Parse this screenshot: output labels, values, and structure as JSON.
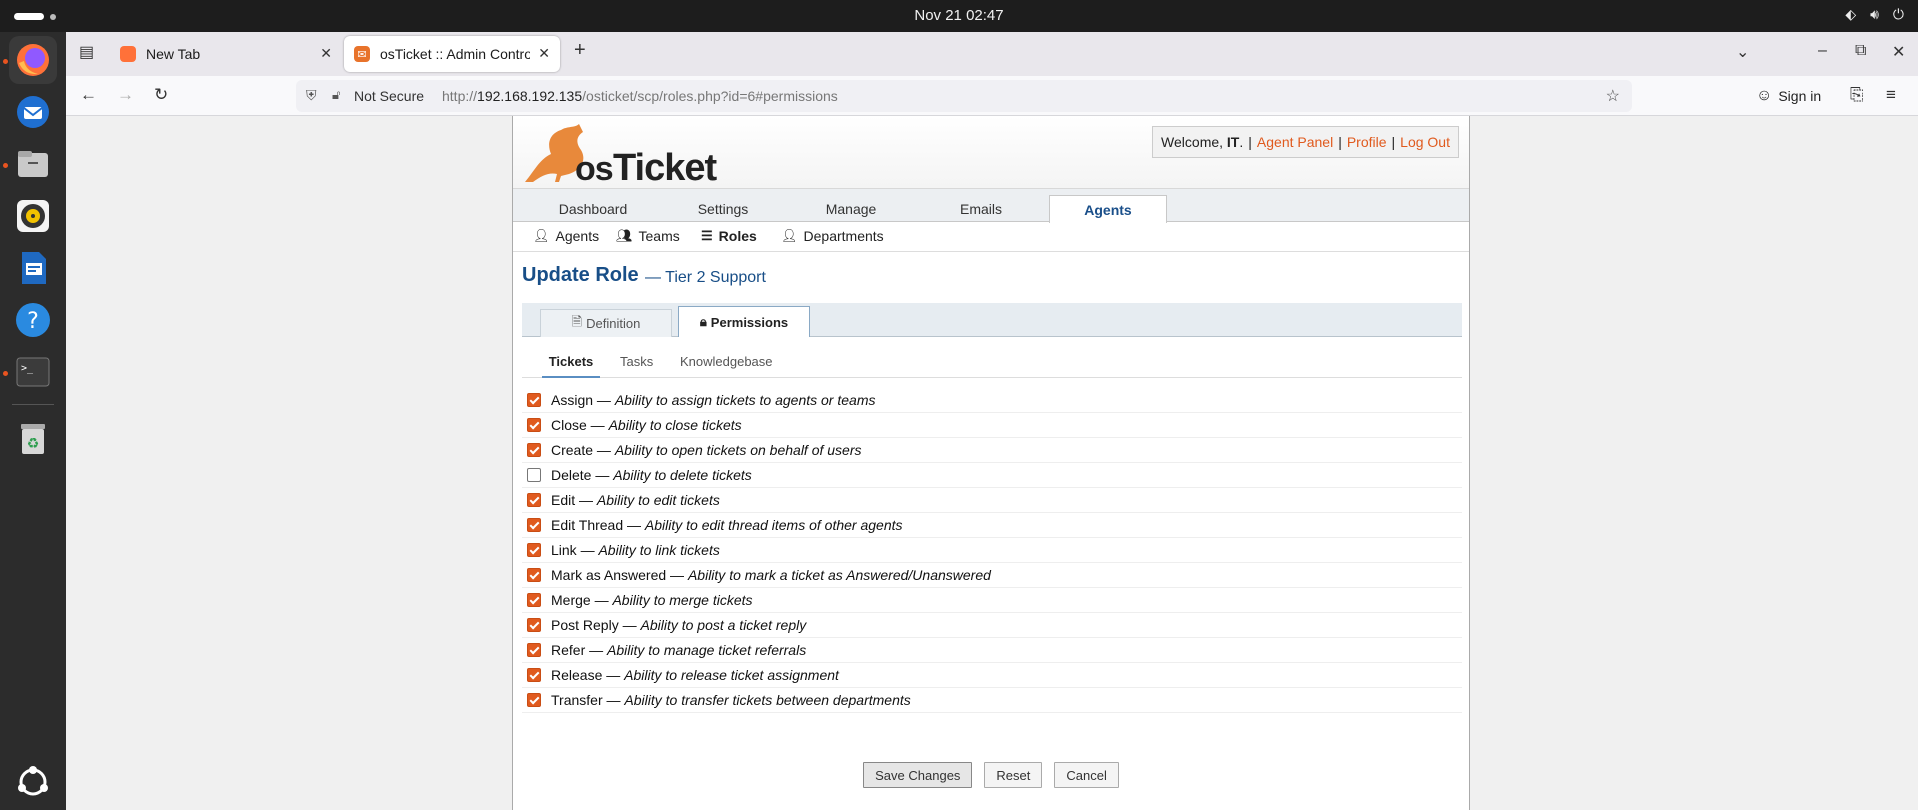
{
  "topbar": {
    "clock": "Nov 21  02:47"
  },
  "dock": {
    "items": [
      "firefox-icon",
      "thunderbird-icon",
      "files-icon",
      "rhythmbox-icon",
      "writer-icon",
      "help-icon",
      "terminal-icon",
      "trash-icon",
      "apps-grid-icon"
    ]
  },
  "browser": {
    "tabs": [
      {
        "title": "New Tab"
      },
      {
        "title": "osTicket :: Admin Control"
      }
    ],
    "url_prefix": "http://",
    "url_host": "192.168.192.135",
    "url_path": "/osticket/scp/roles.php?id=6#permissions",
    "not_secure": "Not Secure",
    "sign_in": "Sign in"
  },
  "header": {
    "welcome_text": "Welcome, ",
    "user": "IT",
    "links": [
      "Agent Panel",
      "Profile",
      "Log Out"
    ]
  },
  "nav": {
    "tabs": [
      "Dashboard",
      "Settings",
      "Manage",
      "Emails",
      "Agents"
    ],
    "active": "Agents"
  },
  "subnav": {
    "items": [
      "Agents",
      "Teams",
      "Roles",
      "Departments"
    ],
    "active": "Roles"
  },
  "page": {
    "title": "Update Role",
    "subtitle": "— Tier 2 Support"
  },
  "role_tabs": {
    "definition": "Definition",
    "permissions": "Permissions",
    "active": "Permissions"
  },
  "perm_tabs": {
    "tickets": "Tickets",
    "tasks": "Tasks",
    "kb": "Knowledgebase",
    "active": "Tickets"
  },
  "permissions": [
    {
      "name": "Assign",
      "desc": "Ability to assign tickets to agents or teams",
      "checked": true
    },
    {
      "name": "Close",
      "desc": "Ability to close tickets",
      "checked": true
    },
    {
      "name": "Create",
      "desc": "Ability to open tickets on behalf of users",
      "checked": true
    },
    {
      "name": "Delete",
      "desc": "Ability to delete tickets",
      "checked": false
    },
    {
      "name": "Edit",
      "desc": "Ability to edit tickets",
      "checked": true
    },
    {
      "name": "Edit Thread",
      "desc": "Ability to edit thread items of other agents",
      "checked": true
    },
    {
      "name": "Link",
      "desc": "Ability to link tickets",
      "checked": true
    },
    {
      "name": "Mark as Answered",
      "desc": "Ability to mark a ticket as Answered/Unanswered",
      "checked": true
    },
    {
      "name": "Merge",
      "desc": "Ability to merge tickets",
      "checked": true
    },
    {
      "name": "Post Reply",
      "desc": "Ability to post a ticket reply",
      "checked": true
    },
    {
      "name": "Refer",
      "desc": "Ability to manage ticket referrals",
      "checked": true
    },
    {
      "name": "Release",
      "desc": "Ability to release ticket assignment",
      "checked": true
    },
    {
      "name": "Transfer",
      "desc": "Ability to transfer tickets between departments",
      "checked": true
    }
  ],
  "buttons": {
    "save": "Save Changes",
    "reset": "Reset",
    "cancel": "Cancel"
  },
  "colors": {
    "accent": "#e05a1e",
    "title_blue": "#184e87",
    "nav_active": "#1a4f8a"
  }
}
